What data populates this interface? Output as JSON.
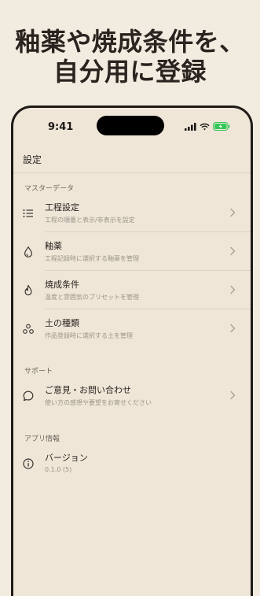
{
  "headline": {
    "line1": "釉薬や焼成条件を、",
    "line2": "自分用に登録"
  },
  "status": {
    "time": "9:41"
  },
  "nav": {
    "title": "設定"
  },
  "sections": {
    "master": "マスターデータ",
    "support": "サポート",
    "app_info": "アプリ情報"
  },
  "rows": [
    {
      "title": "工程設定",
      "subtitle": "工程の順番と表示/非表示を設定",
      "icon": "list-icon"
    },
    {
      "title": "釉薬",
      "subtitle": "工程記録時に選択する釉薬を管理",
      "icon": "droplet-icon"
    },
    {
      "title": "焼成条件",
      "subtitle": "温度と雰囲気のプリセットを管理",
      "icon": "flame-icon"
    },
    {
      "title": "土の種類",
      "subtitle": "作品登録時に選択する土を管理",
      "icon": "clay-icon"
    },
    {
      "title": "ご意見・お問い合わせ",
      "subtitle": "使い方の感想や要望をお寄せください",
      "icon": "chat-bubble-icon"
    },
    {
      "title": "バージョン",
      "subtitle": "0.1.0 (5)",
      "icon": "info-icon"
    }
  ],
  "colors": {
    "background": "#f2ebdf",
    "screen": "#efe6d8",
    "battery": "#34c759"
  }
}
